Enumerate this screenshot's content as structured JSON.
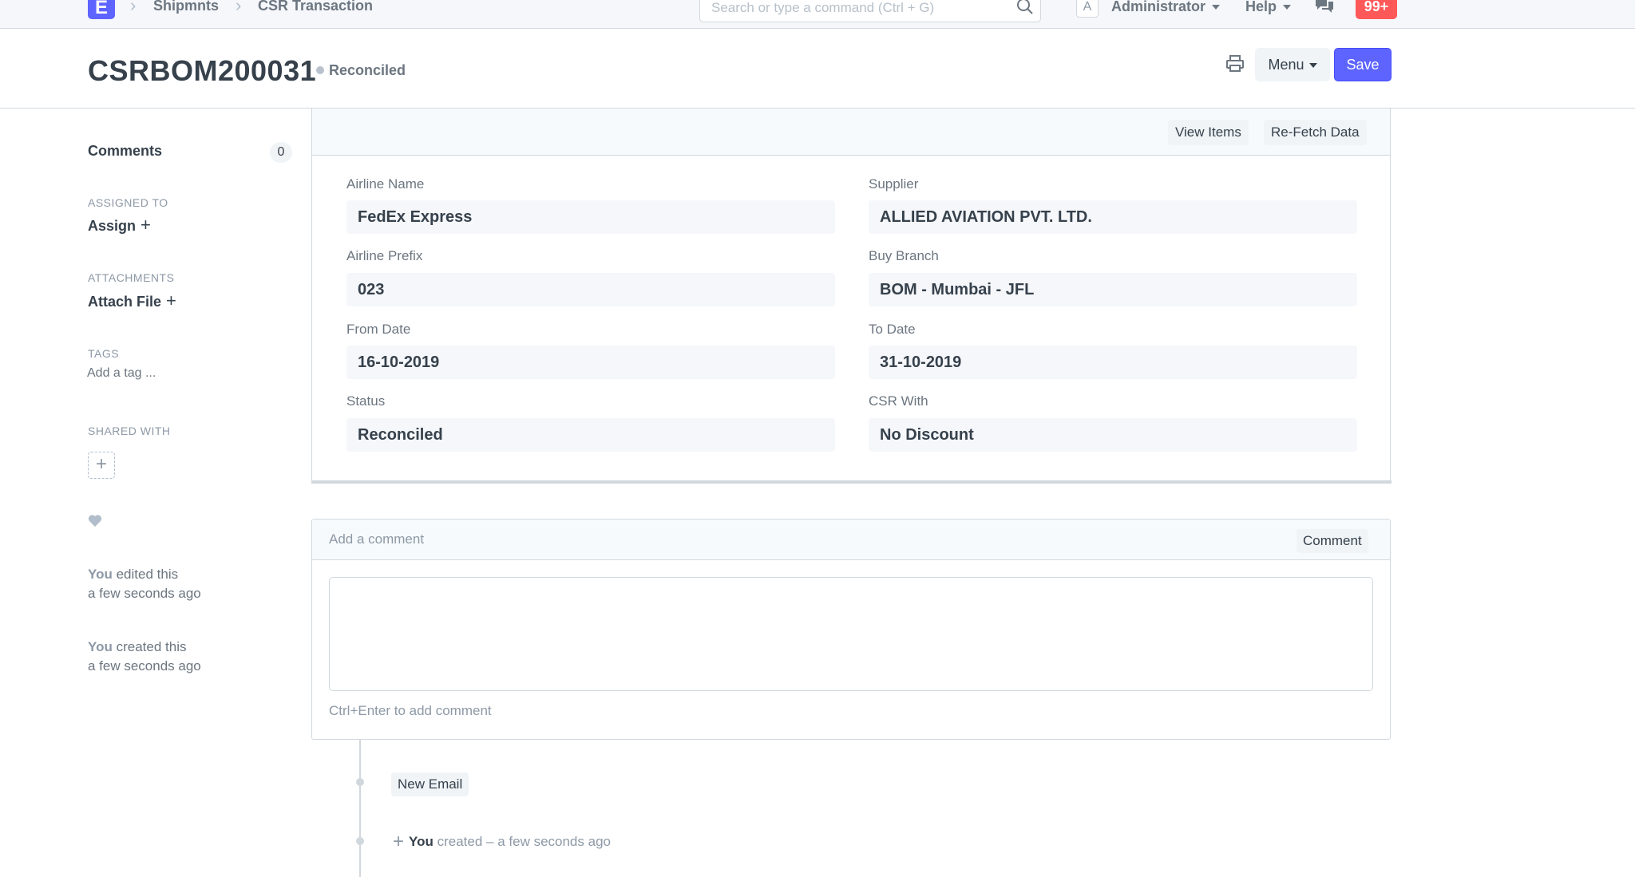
{
  "navbar": {
    "logo_letter": "E",
    "breadcrumbs": [
      "Shipmnts",
      "CSR Transaction"
    ],
    "search_placeholder": "Search or type a command (Ctrl + G)",
    "avatar_letter": "A",
    "user_label": "Administrator",
    "help_label": "Help",
    "notification_count": "99+"
  },
  "page": {
    "title": "CSRBOM200031",
    "status": "Reconciled",
    "menu_label": "Menu",
    "save_label": "Save"
  },
  "sidebar": {
    "comments_label": "Comments",
    "comments_count": "0",
    "assigned_to_label": "ASSIGNED TO",
    "assign_label": "Assign",
    "attachments_label": "ATTACHMENTS",
    "attach_label": "Attach File",
    "tags_label": "TAGS",
    "tag_placeholder": "Add a tag ...",
    "shared_with_label": "SHARED WITH",
    "activity": [
      {
        "who": "You",
        "action": "edited this",
        "when": "a few seconds ago"
      },
      {
        "who": "You",
        "action": "created this",
        "when": "a few seconds ago"
      }
    ]
  },
  "form": {
    "toolbar": {
      "view_items": "View Items",
      "refetch": "Re-Fetch Data"
    },
    "fields": [
      {
        "label": "Airline Name",
        "value": "FedEx Express"
      },
      {
        "label": "Supplier",
        "value": "ALLIED AVIATION PVT. LTD."
      },
      {
        "label": "Airline Prefix",
        "value": "023"
      },
      {
        "label": "Buy Branch",
        "value": "BOM - Mumbai - JFL"
      },
      {
        "label": "From Date",
        "value": "16-10-2019"
      },
      {
        "label": "To Date",
        "value": "31-10-2019"
      },
      {
        "label": "Status",
        "value": "Reconciled"
      },
      {
        "label": "CSR With",
        "value": "No Discount"
      }
    ]
  },
  "comment": {
    "placeholder": "Add a comment",
    "button": "Comment",
    "hint": "Ctrl+Enter to add comment"
  },
  "timeline": {
    "new_email": "New Email",
    "entry_who": "You",
    "entry_text": "created – a few seconds ago"
  },
  "colors": {
    "primary": "#5e64ff",
    "danger": "#ff5858",
    "text": "#36414c",
    "muted": "#8d99a6",
    "border": "#d1d8dd"
  }
}
